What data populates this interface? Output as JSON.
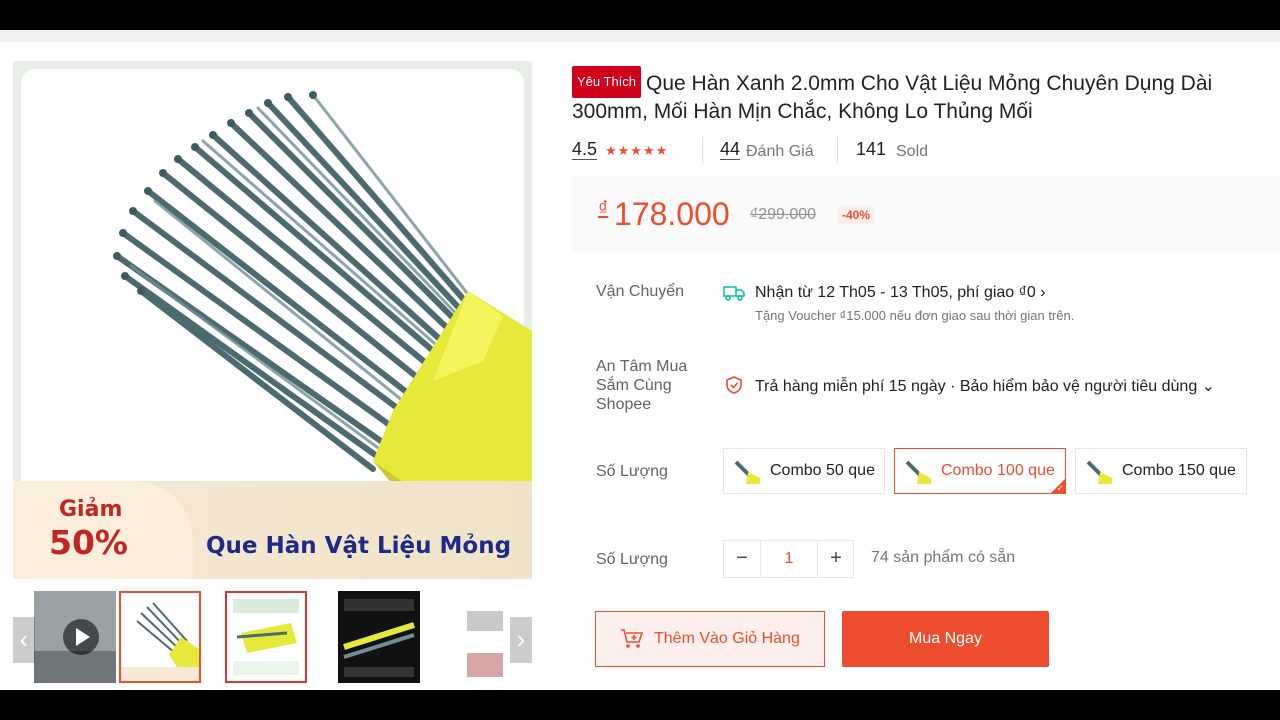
{
  "product": {
    "badge": "Yêu Thích",
    "title": "Que Hàn Xanh 2.0mm Cho Vật Liệu Mỏng Chuyên Dụng Dài 300mm, Mối Hàn Mịn Chắc, Không Lo Thủng Mối",
    "image_promo": {
      "discount_word": "Giảm",
      "discount_value": "50%",
      "caption": "Que Hàn Vật Liệu Mỏng"
    }
  },
  "ratings": {
    "score": "4.5",
    "stars": "★★★★★",
    "review_count": "44",
    "review_label": "Đánh Giá",
    "sold_count": "141",
    "sold_label": "Sold"
  },
  "price": {
    "currency": "₫",
    "current": "178.000",
    "original": "₫299.000",
    "discount": "-40%"
  },
  "shipping": {
    "label": "Vận Chuyển",
    "main": "Nhận từ 12 Th05 - 13 Th05, phí giao ₫0",
    "sub": "Tặng Voucher ₫15.000 nếu đơn giao sau thời gian trên.",
    "icon": "truck-icon"
  },
  "assurance": {
    "label_line1": "An Tâm Mua",
    "label_line2": "Sắm Cùng",
    "label_line3": "Shopee",
    "text": "Trả hàng miễn phí 15 ngày · Bảo hiểm bảo vệ người tiêu dùng",
    "icon": "shield-icon"
  },
  "variants": {
    "label": "Số Lượng",
    "options": [
      {
        "label": "Combo 50 que",
        "selected": false
      },
      {
        "label": "Combo 100 que",
        "selected": true
      },
      {
        "label": "Combo 150 que",
        "selected": false
      }
    ]
  },
  "quantity": {
    "label": "Số Lượng",
    "value": "1",
    "minus": "−",
    "plus": "+",
    "stock": "74 sản phẩm có sẵn"
  },
  "actions": {
    "add_to_cart": "Thêm Vào Giỏ Hàng",
    "buy_now": "Mua Ngay"
  },
  "thumbnails": {
    "prev_arrow": "‹",
    "next_arrow": "›"
  },
  "colors": {
    "accent": "#ee4d2d",
    "badge": "#d0011b",
    "rod_yellow": "#e8ea3a",
    "rod_green": "#4a6b6e"
  }
}
